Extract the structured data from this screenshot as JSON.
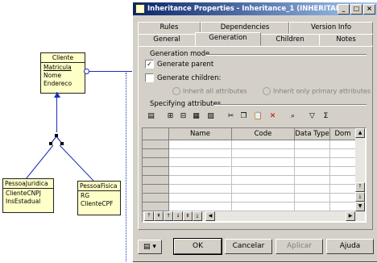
{
  "diagram": {
    "parent_class": {
      "name": "Cliente",
      "attributes": [
        "Matricula",
        "Nome",
        "Endereco"
      ]
    },
    "child_left": {
      "name": "PessoaJuridica",
      "attributes": [
        "ClienteCNPJ",
        "InsEstadual"
      ]
    },
    "child_right": {
      "name": "PessoaFisica",
      "attributes": [
        "RG",
        "ClienteCPF"
      ]
    }
  },
  "dialog": {
    "title": "Inheritance Properties - Inheritance_1 (INHERITANCE_...",
    "window_buttons": [
      "_",
      "□",
      "×"
    ],
    "tabs_back": [
      "Rules",
      "Dependencies",
      "Version Info"
    ],
    "tabs_front": [
      "General",
      "Generation",
      "Children",
      "Notes"
    ],
    "active_tab": "Generation",
    "generation_mode_label": "Generation mode",
    "generate_parent_label": "Generate parent",
    "generate_parent_checked": true,
    "generate_children_label": "Generate children:",
    "generate_children_checked": false,
    "radio_all": "Inherit all attributes",
    "radio_primary": "Inherit only primary attributes",
    "specifying_label": "Specifying attributes",
    "grid_columns": [
      "Name",
      "Code",
      "Data Type",
      "Dom"
    ],
    "buttons": {
      "ok": "OK",
      "cancel": "Cancelar",
      "apply": "Aplicar",
      "help": "Ajuda"
    }
  }
}
